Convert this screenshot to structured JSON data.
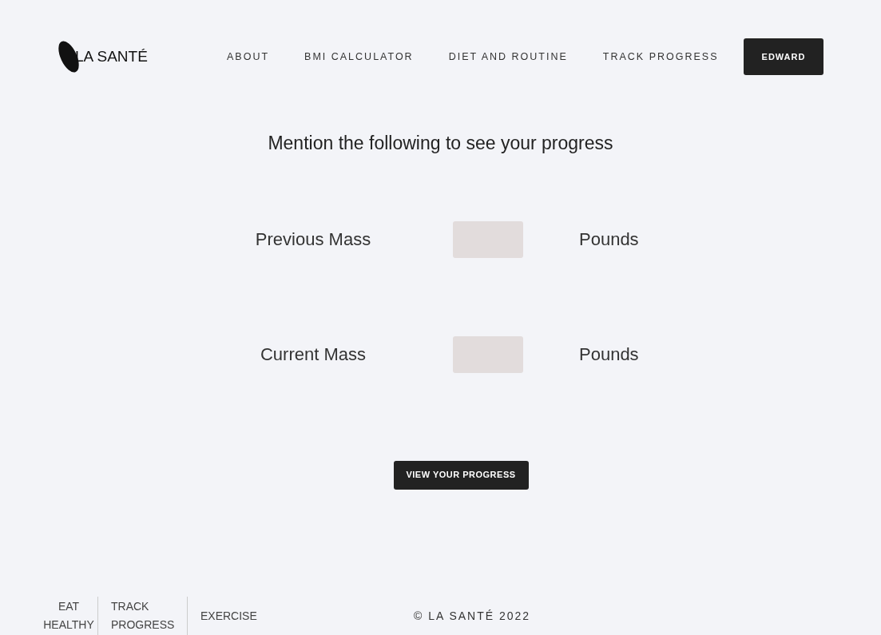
{
  "header": {
    "logo": "LA SANTÉ",
    "nav": [
      {
        "label": "ABOUT"
      },
      {
        "label": "BMI CALCULATOR"
      },
      {
        "label": "DIET AND ROUTINE"
      },
      {
        "label": "TRACK PROGRESS"
      }
    ],
    "user_button": "EDWARD"
  },
  "form": {
    "heading": "Mention the following to see your progress",
    "fields": [
      {
        "label": "Previous Mass",
        "unit": "Pounds"
      },
      {
        "label": "Current Mass",
        "unit": "Pounds"
      }
    ],
    "submit": "VIEW YOUR PROGRESS"
  },
  "footer": {
    "links": [
      {
        "label": "EAT HEALTHY"
      },
      {
        "label": "TRACK PROGRESS"
      },
      {
        "label": "EXERCISE"
      }
    ],
    "copyright": "© LA SANTÉ 2022"
  }
}
